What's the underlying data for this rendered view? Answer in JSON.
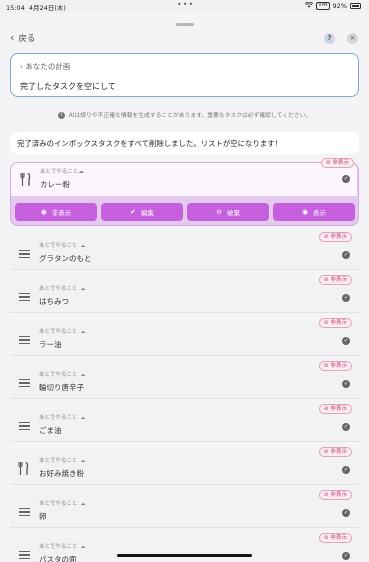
{
  "status_bar": {
    "time": "15:04",
    "date": "4月24日(木)",
    "battery": "92%",
    "vpn": "VPN"
  },
  "header": {
    "back_label": "戻る",
    "help": "?",
    "close": "×"
  },
  "plan": {
    "title": "あなたの計画",
    "input_value": "完了したタスクを空にして"
  },
  "ai_note": "AIは誤りや不正確な情報を生成することがあります。重要なタスクは必ず確認してください。",
  "message": "完了済みのインボックスタスクをすべて削除しました。リストが空になります！",
  "badge_label": "非表示",
  "selected_item": {
    "small_label": "あとでやること",
    "title": "カレー粉",
    "icon": "fork-knife-icon",
    "actions": [
      {
        "label": "非表示",
        "icon": "eye-slash-icon"
      },
      {
        "label": "編集",
        "icon": "check-circle-icon"
      },
      {
        "label": "破棄",
        "icon": "remove-circle-icon"
      },
      {
        "label": "表示",
        "icon": "eye-icon"
      }
    ]
  },
  "items": [
    {
      "small_label": "あとでやること",
      "title": "グラタンのもと",
      "icon": "list-icon"
    },
    {
      "small_label": "あとでやること",
      "title": "はちみつ",
      "icon": "list-icon"
    },
    {
      "small_label": "あとでやること",
      "title": "ラー油",
      "icon": "list-icon"
    },
    {
      "small_label": "あとでやること",
      "title": "輪切り唐辛子",
      "icon": "list-icon"
    },
    {
      "small_label": "あとでやること",
      "title": "ごま油",
      "icon": "list-icon"
    },
    {
      "small_label": "あとでやること",
      "title": "お好み焼き粉",
      "icon": "fork-knife-icon"
    },
    {
      "small_label": "あとでやること",
      "title": "卵",
      "icon": "list-icon"
    },
    {
      "small_label": "あとでやること",
      "title": "パスタの面",
      "icon": "list-icon"
    }
  ]
}
